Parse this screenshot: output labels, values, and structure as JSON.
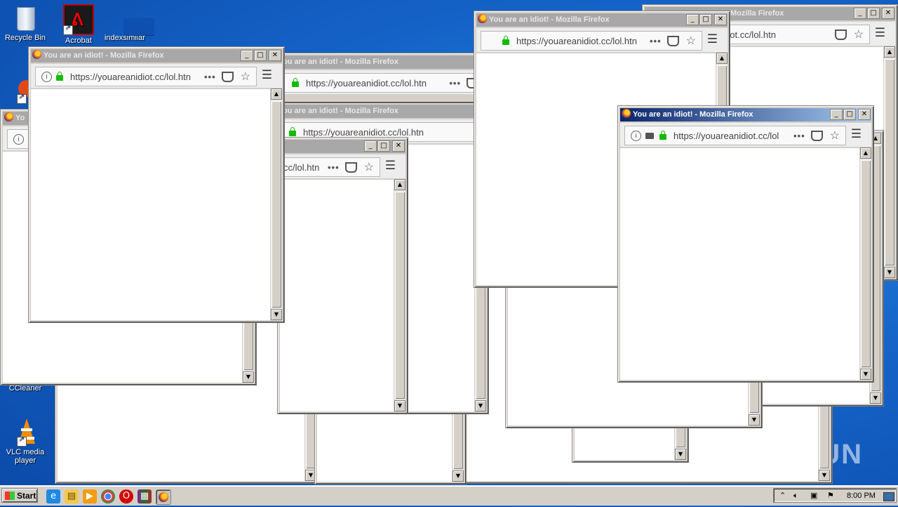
{
  "desktop": {
    "icons": [
      {
        "name": "recycle-bin",
        "label": "Recycle Bin"
      },
      {
        "name": "acrobat",
        "label": "Acrobat"
      },
      {
        "name": "indexsimilar",
        "label": "indexsimilar"
      },
      {
        "name": "ccleaner",
        "label": "CCleaner"
      },
      {
        "name": "vlc",
        "label": "VLC media player"
      }
    ]
  },
  "window_title": "You are an idiot! - Mozilla Firefox",
  "window_title_partial": {
    "a": "ou are an idiot! - Mozilla Firefox",
    "b": "Mozilla Firefox",
    "c": "Yo"
  },
  "url": "https://youareanidiot.cc/lol.htn",
  "url_partial": {
    "a": "https://youareanidiot.cc/lol",
    "b": "cc/lol.htn"
  },
  "titlebar_buttons": {
    "minimize": "_",
    "maximize": "□",
    "close": "✕"
  },
  "taskbar": {
    "start_label": "Start",
    "clock": "8:00 PM",
    "quick_launch": [
      "internet-explorer-icon",
      "explorer-icon",
      "media-player-icon",
      "chrome-icon",
      "opera-icon",
      "winrar-icon",
      "firefox-icon"
    ]
  },
  "watermark": "ANY RUN",
  "colors": {
    "titlebar_active": "#0a246a",
    "titlebar_inactive": "#a8a8a8",
    "lock_green": "#12bc00"
  }
}
